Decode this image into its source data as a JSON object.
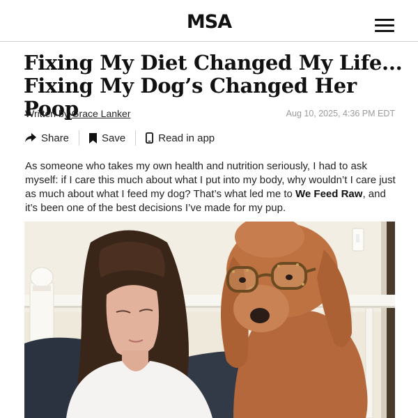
{
  "header": {
    "logo": "MSA",
    "menu_icon": "hamburger-menu-icon"
  },
  "article": {
    "headline_line1": "Fixing My Diet Changed My Life...",
    "headline_line2": "Fixing My Dog’s Changed Her Poop",
    "byline_prefix": "Written by",
    "author": "Grace Lanker",
    "timestamp": "Aug 10, 2025, 4:36 PM EDT",
    "actions": {
      "share_label": "Share",
      "save_label": "Save",
      "read_label": "Read in app"
    },
    "intro_text": "As someone who takes my own health and nutrition seriously, I had to ask myself: if I care this much about what I put into my body, why wouldn’t I care just as much about what I feed my dog? That’s what led me to ",
    "intro_brand": "We Feed Raw",
    "intro_end": ", and it’s been one of the best decisions I’ve made for my pup."
  },
  "icons": [
    "share-icon",
    "bookmark-icon",
    "phone-icon"
  ],
  "colors": {
    "text": "#222222",
    "muted": "#9a9a9a",
    "divider": "#cfcfcf"
  }
}
